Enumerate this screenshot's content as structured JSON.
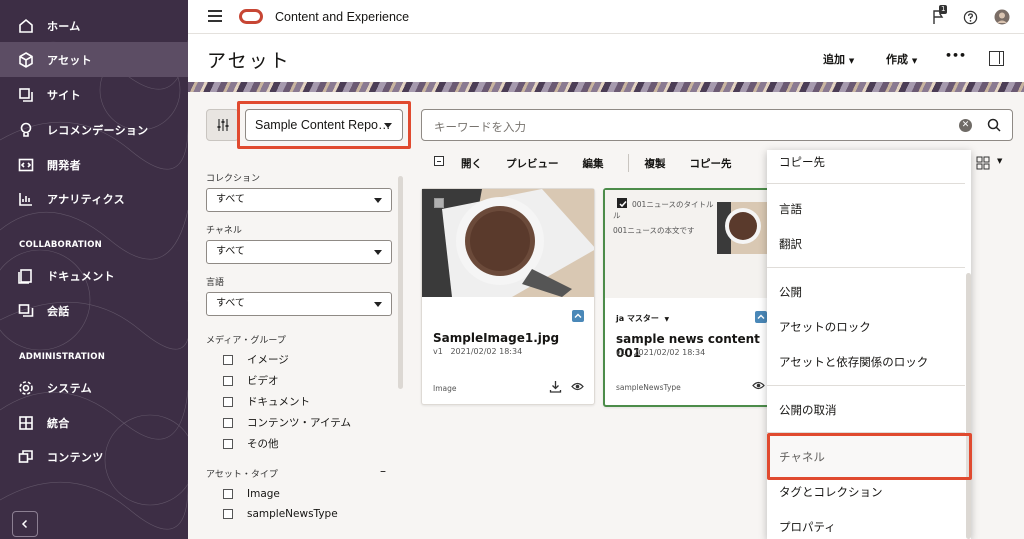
{
  "sidebar": {
    "items": [
      {
        "label": "ホーム",
        "icon": "home-icon"
      },
      {
        "label": "アセット",
        "icon": "cube-icon"
      },
      {
        "label": "サイト",
        "icon": "sites-icon"
      },
      {
        "label": "レコメンデーション",
        "icon": "lightbulb-icon"
      },
      {
        "label": "開発者",
        "icon": "code-icon"
      },
      {
        "label": "アナリティクス",
        "icon": "chart-icon"
      }
    ],
    "collab_heading": "COLLABORATION",
    "collab_items": [
      {
        "label": "ドキュメント",
        "icon": "document-icon"
      },
      {
        "label": "会話",
        "icon": "conversation-icon"
      }
    ],
    "admin_heading": "ADMINISTRATION",
    "admin_items": [
      {
        "label": "システム",
        "icon": "gear-icon"
      },
      {
        "label": "統合",
        "icon": "integration-icon"
      },
      {
        "label": "コンテンツ",
        "icon": "content-icon"
      }
    ],
    "collapse_icon": "chevron-left-icon",
    "colors": {
      "background": "#3d2e45",
      "active": "#5c4d64"
    }
  },
  "topbar": {
    "app_title": "Content and Experience",
    "notification_count": "1"
  },
  "header": {
    "title": "アセット",
    "add_label": "追加",
    "create_label": "作成",
    "more_label": "•••"
  },
  "filters": {
    "repository": "Sample Content Repo…",
    "search_placeholder": "キーワードを入力",
    "collection_label": "コレクション",
    "collection_value": "すべて",
    "channel_label": "チャネル",
    "channel_value": "すべて",
    "language_label": "言語",
    "language_value": "すべて",
    "media_group_label": "メディア・グループ",
    "media_groups": [
      "イメージ",
      "ビデオ",
      "ドキュメント",
      "コンテンツ・アイテム",
      "その他"
    ],
    "asset_type_label": "アセット・タイプ",
    "asset_type_collapse": "–",
    "asset_types": [
      "Image",
      "sampleNewsType"
    ]
  },
  "actions": {
    "items": [
      "開く",
      "プレビュー",
      "編集",
      "複製",
      "コピー先"
    ]
  },
  "cards": [
    {
      "title": "SampleImage1.jpg",
      "version": "v1",
      "date": "2021/02/02 18:34",
      "type": "Image"
    },
    {
      "title": "sample news content 001",
      "version": "v1",
      "date": "2021/02/02 18:34",
      "type": "sampleNewsType",
      "language": "ja",
      "master_label": "マスター",
      "news_title": "001ニュースのタイトル",
      "news_body": "001ニュースの本文です"
    }
  ],
  "context_menu": {
    "items": [
      "コピー先",
      "言語",
      "翻訳",
      "公開",
      "アセットのロック",
      "アセットと依存関係のロック",
      "公開の取消",
      "チャネル",
      "タグとコレクション",
      "プロパティ"
    ]
  },
  "colors": {
    "accent_red": "#e04a2f",
    "oracle_red": "#c74634",
    "badge_blue": "#4a88b8",
    "selected_green": "#4c8c4a"
  }
}
